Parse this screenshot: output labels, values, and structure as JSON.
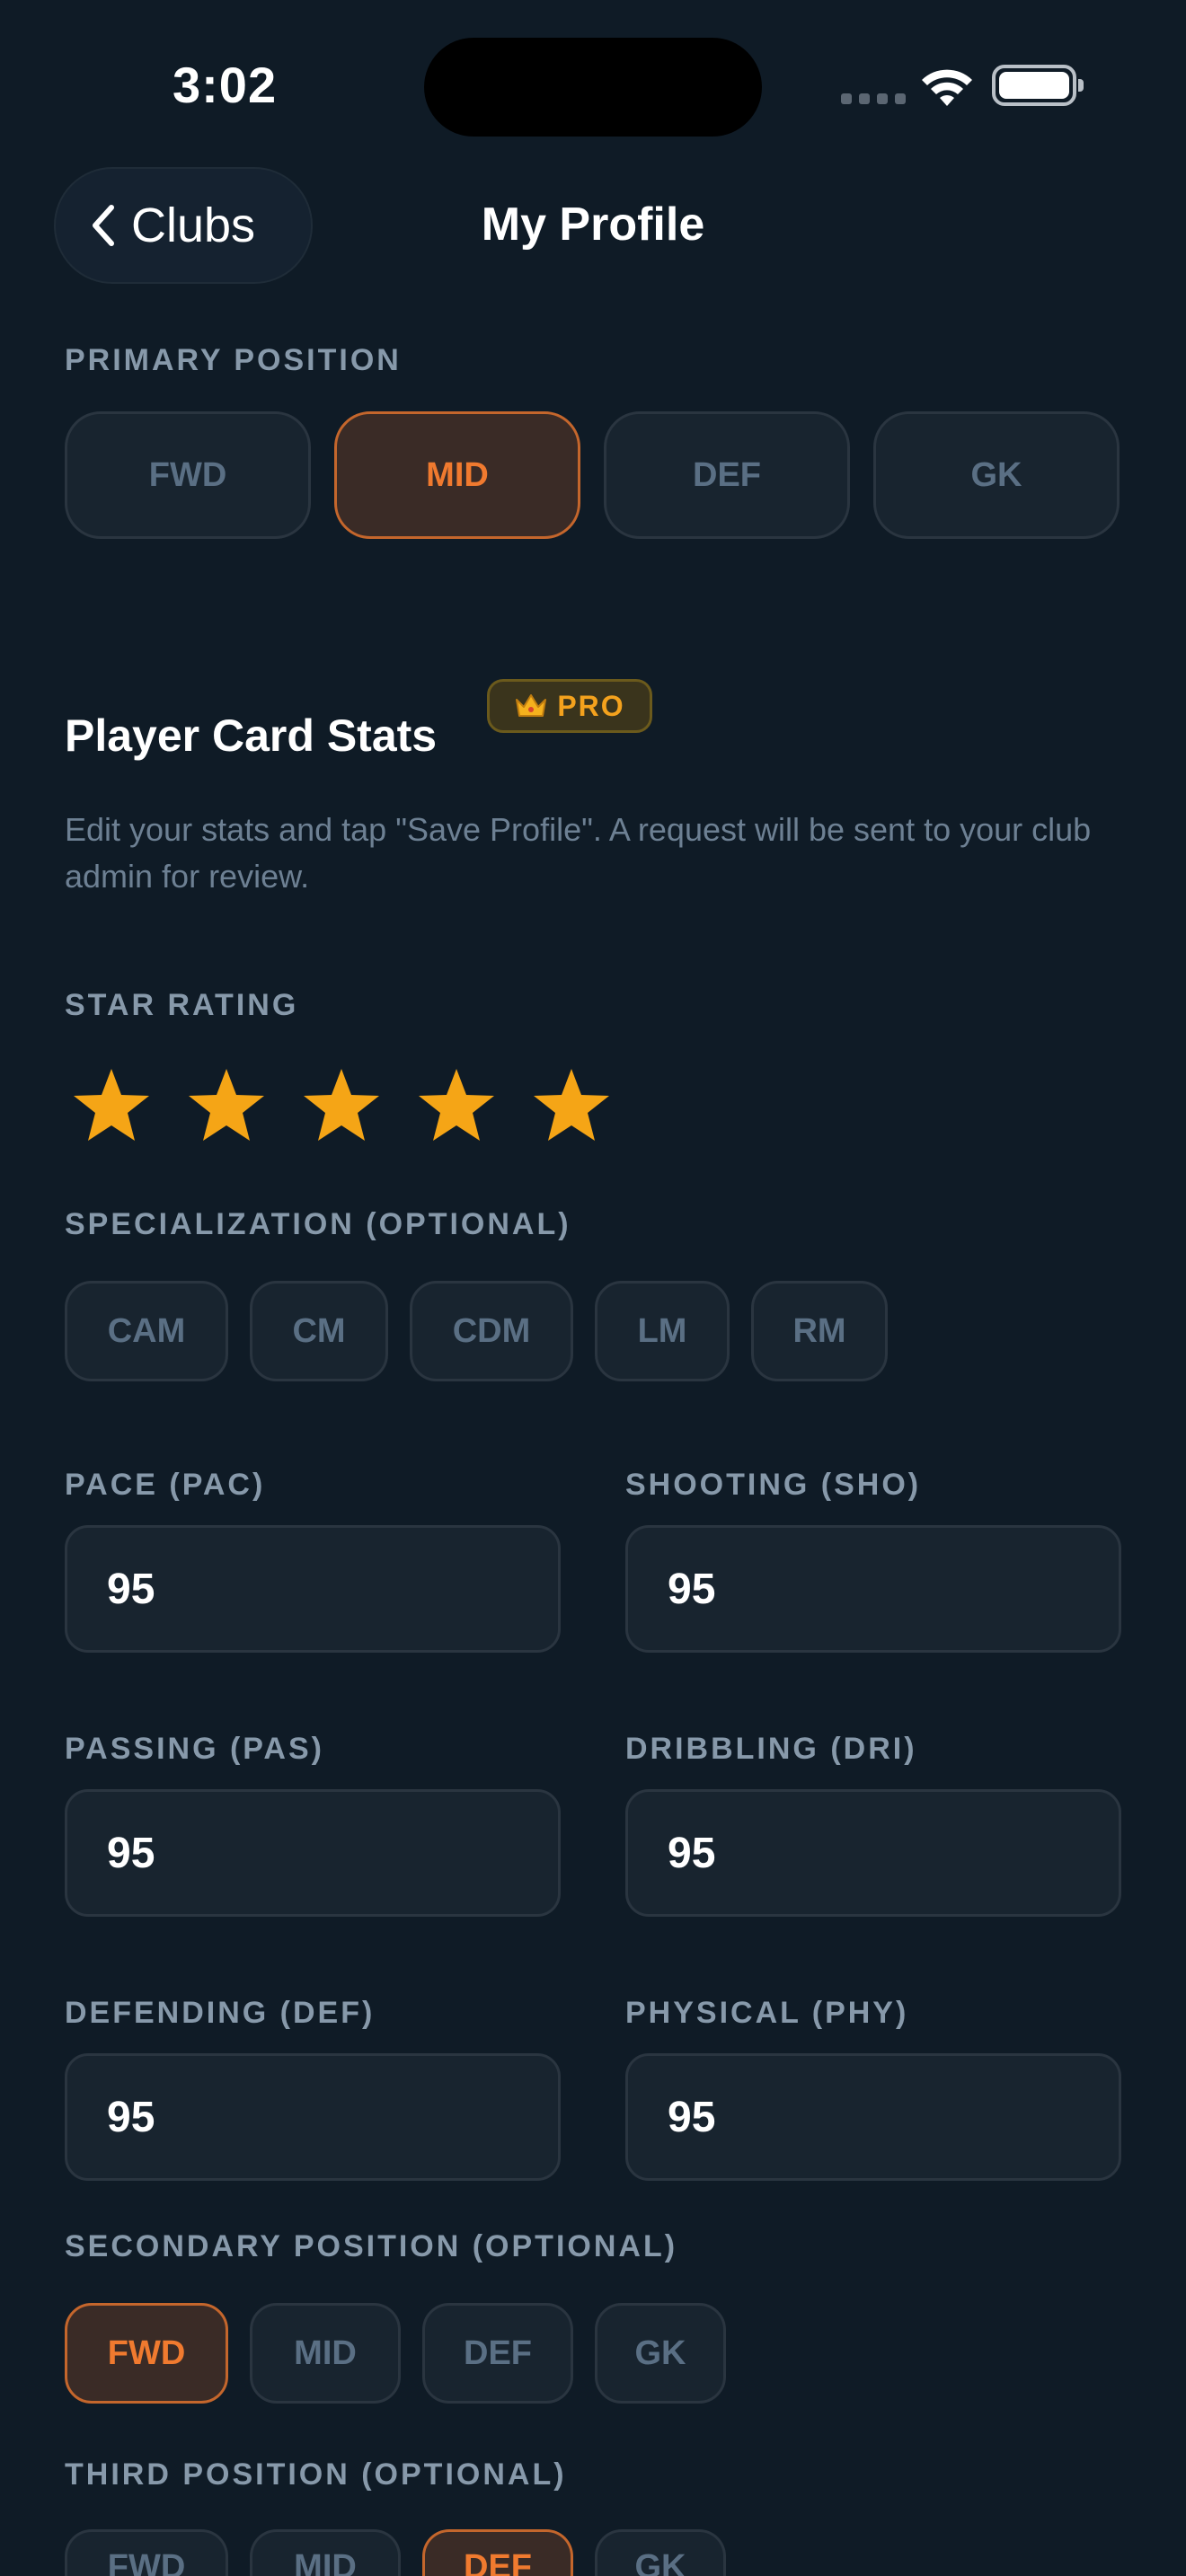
{
  "status_bar": {
    "time": "3:02"
  },
  "nav": {
    "back_label": "Clubs",
    "title": "My Profile"
  },
  "primary_position": {
    "label": "PRIMARY POSITION",
    "options": [
      "FWD",
      "MID",
      "DEF",
      "GK"
    ],
    "selected": "MID"
  },
  "player_card": {
    "title": "Player Card Stats",
    "badge": "PRO",
    "description": "Edit your stats and tap \"Save Profile\". A request will be sent to your club admin for review."
  },
  "star_rating": {
    "label": "STAR RATING",
    "value": 5,
    "max": 5
  },
  "specialization": {
    "label": "SPECIALIZATION (OPTIONAL)",
    "options": [
      "CAM",
      "CM",
      "CDM",
      "LM",
      "RM"
    ]
  },
  "stats": [
    {
      "label": "PACE (PAC)",
      "value": "95"
    },
    {
      "label": "SHOOTING (SHO)",
      "value": "95"
    },
    {
      "label": "PASSING (PAS)",
      "value": "95"
    },
    {
      "label": "DRIBBLING (DRI)",
      "value": "95"
    },
    {
      "label": "DEFENDING (DEF)",
      "value": "95"
    },
    {
      "label": "PHYSICAL (PHY)",
      "value": "95"
    }
  ],
  "secondary_position": {
    "label": "SECONDARY POSITION (OPTIONAL)",
    "options": [
      "FWD",
      "MID",
      "DEF",
      "GK"
    ],
    "selected": "FWD"
  },
  "third_position": {
    "label": "THIRD POSITION (OPTIONAL)",
    "options": [
      "FWD",
      "MID",
      "DEF",
      "GK"
    ],
    "selected": "DEF"
  },
  "colors": {
    "accent": "#f07a2f",
    "star": "#f5a516",
    "background": "#0f1b26"
  }
}
